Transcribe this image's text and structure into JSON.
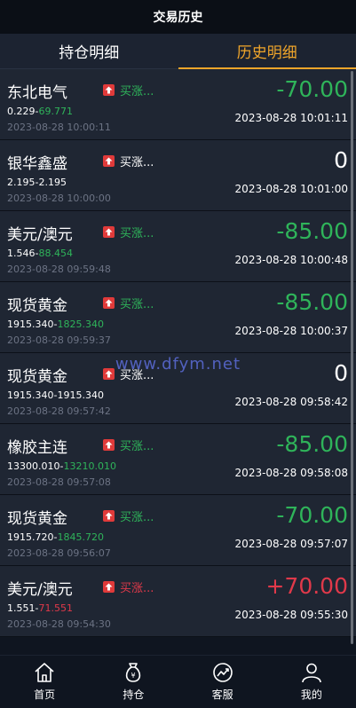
{
  "header": {
    "title": "交易历史"
  },
  "tabs": [
    {
      "label": "持仓明细",
      "active": false
    },
    {
      "label": "历史明细",
      "active": true
    }
  ],
  "rows": [
    {
      "name": "东北电气",
      "direction": "买涨...",
      "dir_color": "green",
      "open": "0.229",
      "close": "69.771",
      "close_color": "green",
      "open_time": "2023-08-28 10:00:11",
      "pl": "-70.00",
      "pl_color": "green",
      "close_time": "2023-08-28 10:01:11"
    },
    {
      "name": "银华鑫盛",
      "direction": "买涨...",
      "dir_color": "white",
      "open": "2.195",
      "close": "2.195",
      "close_color": "white",
      "open_time": "2023-08-28 10:00:00",
      "pl": "0",
      "pl_color": "white",
      "close_time": "2023-08-28 10:01:00"
    },
    {
      "name": "美元/澳元",
      "direction": "买涨...",
      "dir_color": "green",
      "open": "1.546",
      "close": "88.454",
      "close_color": "green",
      "open_time": "2023-08-28 09:59:48",
      "pl": "-85.00",
      "pl_color": "green",
      "close_time": "2023-08-28 10:00:48"
    },
    {
      "name": "现货黄金",
      "direction": "买涨...",
      "dir_color": "green",
      "open": "1915.340",
      "close": "1825.340",
      "close_color": "green",
      "open_time": "2023-08-28 09:59:37",
      "pl": "-85.00",
      "pl_color": "green",
      "close_time": "2023-08-28 10:00:37"
    },
    {
      "name": "现货黄金",
      "direction": "买涨...",
      "dir_color": "white",
      "open": "1915.340",
      "close": "1915.340",
      "close_color": "white",
      "open_time": "2023-08-28 09:57:42",
      "pl": "0",
      "pl_color": "white",
      "close_time": "2023-08-28 09:58:42"
    },
    {
      "name": "橡胶主连",
      "direction": "买涨...",
      "dir_color": "green",
      "open": "13300.010",
      "close": "13210.010",
      "close_color": "green",
      "open_time": "2023-08-28 09:57:08",
      "pl": "-85.00",
      "pl_color": "green",
      "close_time": "2023-08-28 09:58:08"
    },
    {
      "name": "现货黄金",
      "direction": "买涨...",
      "dir_color": "green",
      "open": "1915.720",
      "close": "1845.720",
      "close_color": "green",
      "open_time": "2023-08-28 09:56:07",
      "pl": "-70.00",
      "pl_color": "green",
      "close_time": "2023-08-28 09:57:07"
    },
    {
      "name": "美元/澳元",
      "direction": "买涨...",
      "dir_color": "red",
      "open": "1.551",
      "close": "71.551",
      "close_color": "red",
      "open_time": "2023-08-28 09:54:30",
      "pl": "+70.00",
      "pl_color": "red",
      "close_time": "2023-08-28 09:55:30"
    }
  ],
  "watermark": "www.dfym.net",
  "footer": [
    {
      "label": "首页",
      "icon": "home-icon"
    },
    {
      "label": "持仓",
      "icon": "money-bag-icon"
    },
    {
      "label": "客服",
      "icon": "trend-chart-icon"
    },
    {
      "label": "我的",
      "icon": "user-icon"
    }
  ],
  "colors": {
    "green": "#2fb45a",
    "red": "#e0394a",
    "accent": "#f0a52a"
  }
}
